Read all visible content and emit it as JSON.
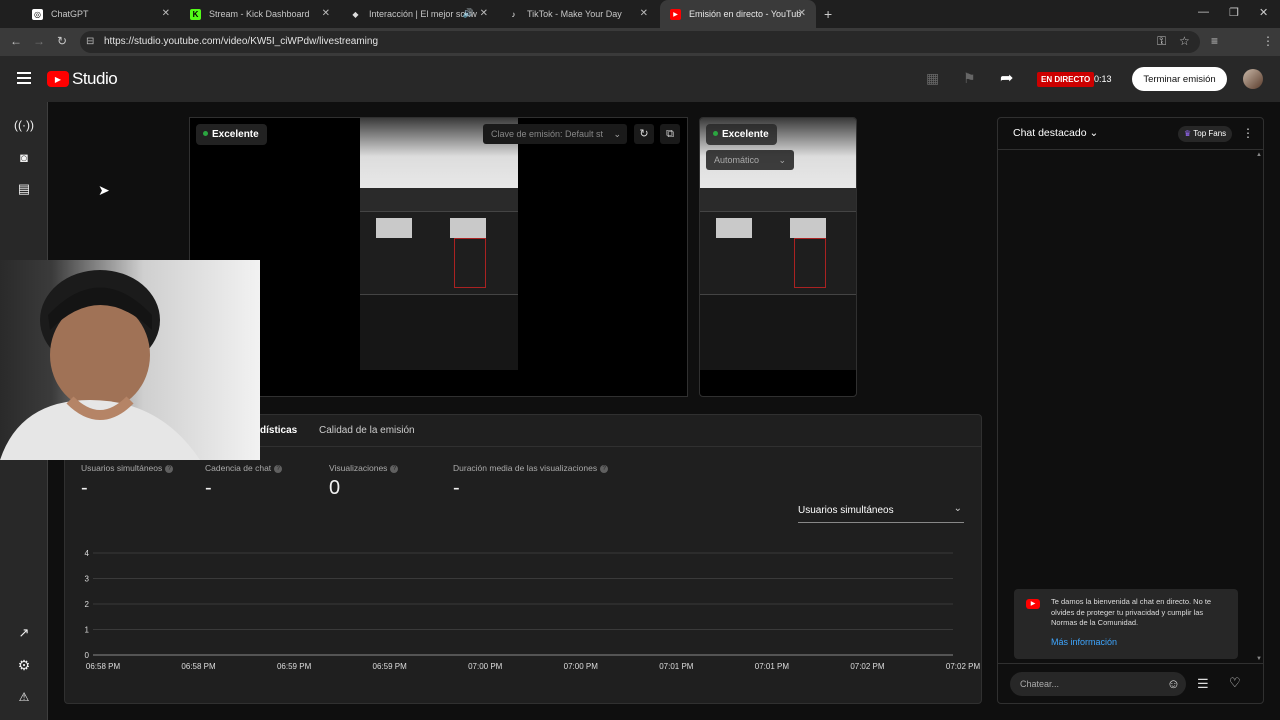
{
  "browser": {
    "tabs": [
      {
        "title": "ChatGPT",
        "icon": "chatgpt-icon"
      },
      {
        "title": "Stream - Kick Dashboard",
        "icon": "kick-icon"
      },
      {
        "title": "Interacción | El mejor softw",
        "icon": "diamond-icon"
      },
      {
        "title": "TikTok - Make Your Day",
        "icon": "tiktok-icon"
      },
      {
        "title": "Emisión en directo - YouTube S",
        "icon": "youtube-icon"
      }
    ],
    "url": "https://studio.youtube.com/video/KW5I_ciWPdw/livestreaming"
  },
  "header": {
    "logo_text": "Studio",
    "live_badge": "EN DIRECTO",
    "live_time": "0:13",
    "end_button": "Terminar emisión"
  },
  "preview": {
    "status_left": "Excelente",
    "stream_key_label": "Clave de emisión: Default st",
    "status_right": "Excelente",
    "quality_select": "Automático"
  },
  "tabs": {
    "stats_partial": "dísticas",
    "quality": "Calidad de la emisión"
  },
  "metrics": [
    {
      "label": "Usuarios simultáneos",
      "value": "-"
    },
    {
      "label": "Cadencia de chat",
      "value": "-"
    },
    {
      "label": "Visualizaciones",
      "value": "0"
    },
    {
      "label": "Duración media de las visualizaciones",
      "value": "-"
    }
  ],
  "metric_select": "Usuarios simultáneos",
  "chart_data": {
    "type": "line",
    "x": [
      "06:58 PM",
      "06:58 PM",
      "06:59 PM",
      "06:59 PM",
      "07:00 PM",
      "07:00 PM",
      "07:01 PM",
      "07:01 PM",
      "07:02 PM",
      "07:02 PM"
    ],
    "yticks": [
      0,
      1,
      2,
      3,
      4
    ],
    "ylim": [
      0,
      4
    ],
    "series": [],
    "grid": true
  },
  "chat": {
    "title": "Chat destacado",
    "top_fans": "Top Fans",
    "welcome": "Te damos la bienvenida al chat en directo. No te olvides de proteger tu privacidad y cumplir las Normas de la Comunidad.",
    "more_info": "Más información",
    "input_placeholder": "Chatear..."
  },
  "colors": {
    "live_red": "#cc0000",
    "status_green": "#2ba640",
    "link_blue": "#3ea6ff"
  }
}
